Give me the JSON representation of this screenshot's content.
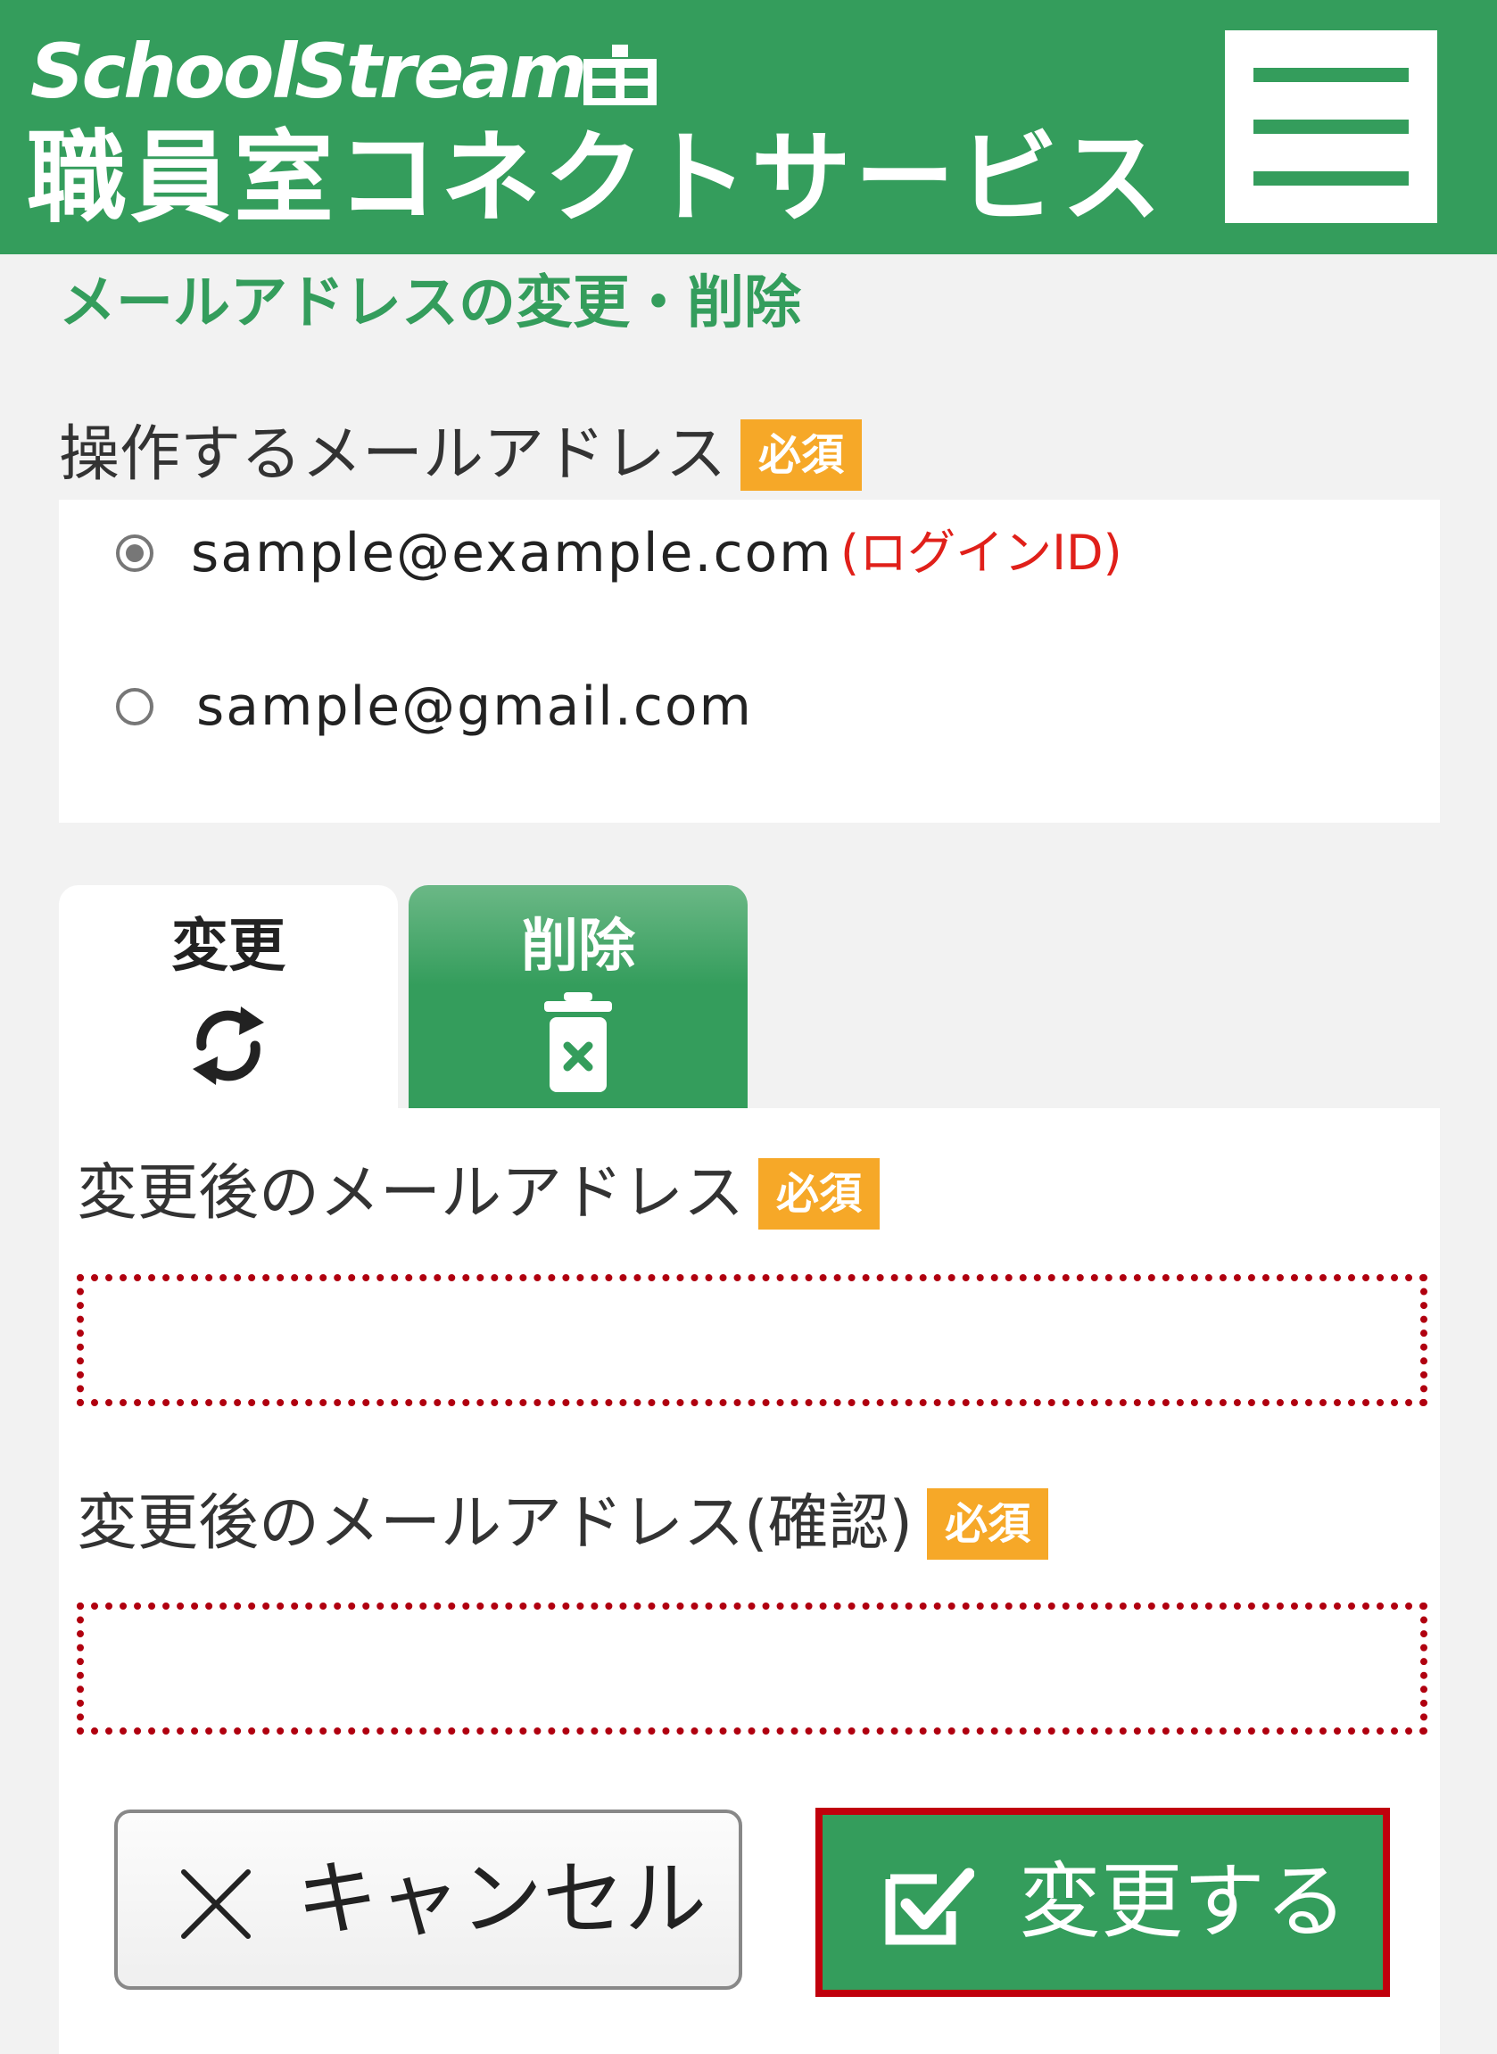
{
  "header": {
    "brand": "SchoolStream",
    "service_name": "職員室コネクトサービス",
    "menu_icon": "hamburger-menu-icon"
  },
  "page": {
    "title": "メールアドレスの変更・削除"
  },
  "target_email": {
    "label": "操作するメールアドレス",
    "required_badge": "必須",
    "options": [
      {
        "value": "sample@example.com",
        "note": "(ログインID)",
        "checked": true
      },
      {
        "value": "sample@gmail.com",
        "note": "",
        "checked": false
      }
    ]
  },
  "tabs": [
    {
      "label": "変更",
      "icon": "refresh-icon",
      "active": true
    },
    {
      "label": "削除",
      "icon": "trash-icon",
      "active": false
    }
  ],
  "new_email": {
    "label": "変更後のメールアドレス",
    "required_badge": "必須",
    "value": ""
  },
  "confirm_email": {
    "label": "変更後のメールアドレス(確認)",
    "required_badge": "必須",
    "value": ""
  },
  "actions": {
    "cancel_label": "キャンセル",
    "cancel_icon": "close-icon",
    "submit_label": "変更する",
    "submit_icon": "checkbox-check-icon"
  },
  "colors": {
    "brand_green": "#349d5c",
    "required_orange": "#f6a828",
    "highlight_red": "#c0000c",
    "note_red": "#e0201a"
  }
}
